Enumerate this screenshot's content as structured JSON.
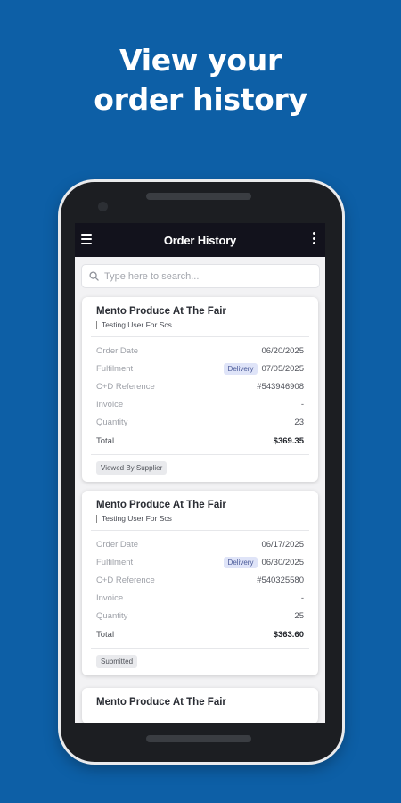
{
  "headline": {
    "line1": "View your",
    "line2": "order history"
  },
  "appbar": {
    "title": "Order History",
    "menu_icon": "hamburger-menu-icon",
    "more_icon": "more-vertical-icon"
  },
  "search": {
    "placeholder": "Type here to search...",
    "value": "",
    "icon": "search-icon"
  },
  "labels": {
    "order_date": "Order Date",
    "fulfilment": "Fulfilment",
    "reference": "C+D Reference",
    "invoice": "Invoice",
    "quantity": "Quantity",
    "total": "Total"
  },
  "orders": [
    {
      "shop": "Mento Produce At The Fair",
      "user": "Testing User For Scs",
      "order_date": "06/20/2025",
      "fulfilment_type": "Delivery",
      "fulfilment_date": "07/05/2025",
      "reference": "#543946908",
      "invoice": "-",
      "quantity": "23",
      "total": "$369.35",
      "status": "Viewed By Supplier"
    },
    {
      "shop": "Mento Produce At The Fair",
      "user": "Testing User For Scs",
      "order_date": "06/17/2025",
      "fulfilment_type": "Delivery",
      "fulfilment_date": "06/30/2025",
      "reference": "#540325580",
      "invoice": "-",
      "quantity": "25",
      "total": "$363.60",
      "status": "Submitted"
    },
    {
      "shop": "Mento Produce At The Fair"
    }
  ],
  "colors": {
    "background": "#0d5fa6",
    "appbar": "#12121c",
    "pill": "#dfe4f8",
    "status": "#e9eaed"
  }
}
